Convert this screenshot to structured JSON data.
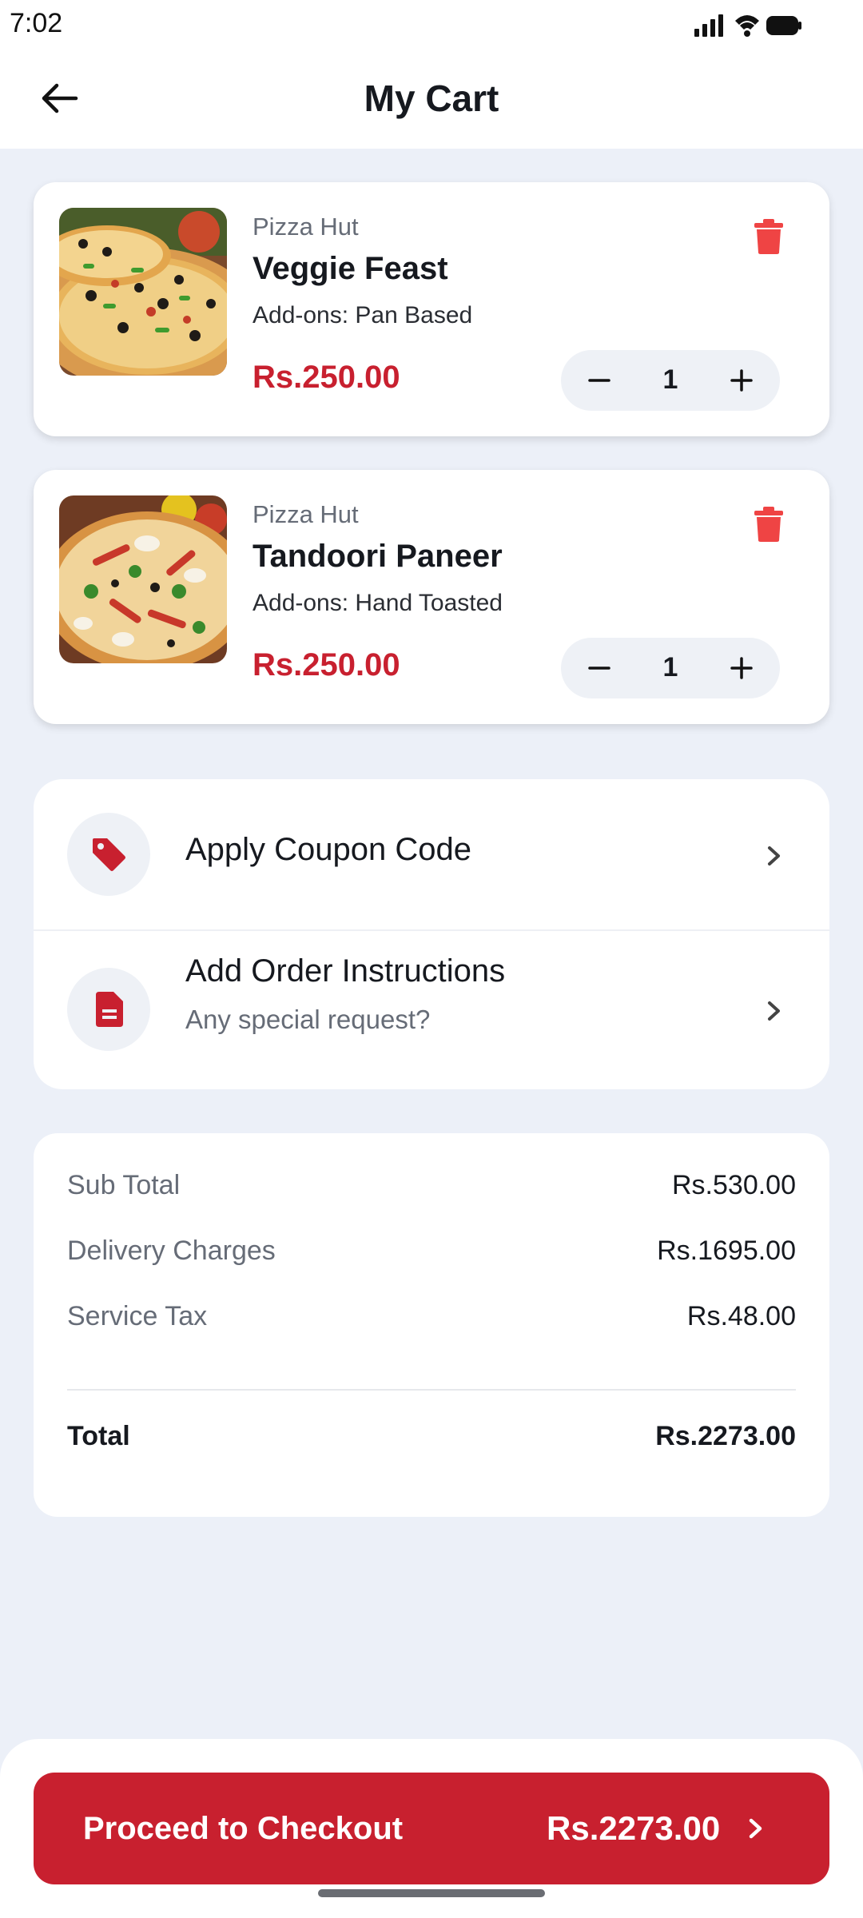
{
  "status": {
    "time": "7:02"
  },
  "header": {
    "title": "My Cart"
  },
  "cart": {
    "items": [
      {
        "restaurant": "Pizza Hut",
        "name": "Veggie Feast",
        "addons": "Add-ons: Pan Based",
        "price": "Rs.250.00",
        "quantity": "1"
      },
      {
        "restaurant": "Pizza Hut",
        "name": "Tandoori Paneer",
        "addons": "Add-ons: Hand Toasted",
        "price": "Rs.250.00",
        "quantity": "1"
      }
    ]
  },
  "actions": {
    "coupon": {
      "label": "Apply Coupon Code"
    },
    "instructions": {
      "label": "Add Order Instructions",
      "sub": "Any special request?"
    }
  },
  "summary": {
    "subtotal": {
      "label": "Sub Total",
      "value": "Rs.530.00"
    },
    "delivery": {
      "label": "Delivery Charges",
      "value": "Rs.1695.00"
    },
    "tax": {
      "label": "Service Tax",
      "value": "Rs.48.00"
    },
    "total": {
      "label": "Total",
      "value": "Rs.2273.00"
    }
  },
  "checkout": {
    "label": "Proceed to Checkout",
    "amount": "Rs.2273.00"
  },
  "colors": {
    "accent": "#c8202f",
    "background": "#ecf0f8",
    "delete": "#ef4444"
  },
  "icons": [
    "back-arrow-icon",
    "trash-icon",
    "minus-icon",
    "plus-icon",
    "tag-icon",
    "document-icon",
    "chevron-right-icon"
  ]
}
